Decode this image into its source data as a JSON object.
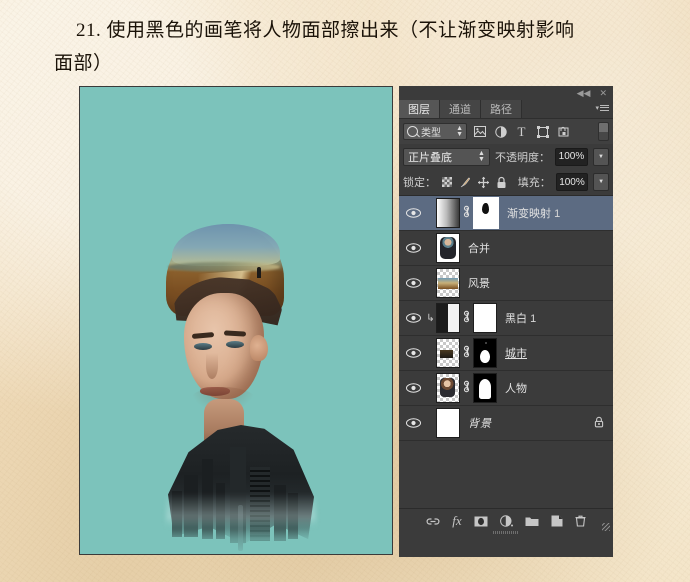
{
  "title": {
    "line1": "21. 使用黑色的画笔将人物面部擦出来（不让渐变映射影响",
    "line2": "面部）"
  },
  "panel": {
    "collapse_icon": "◀◀",
    "close_icon": "✕",
    "tabs": [
      {
        "label": "图层",
        "active": true
      },
      {
        "label": "通道",
        "active": false
      },
      {
        "label": "路径",
        "active": false
      }
    ],
    "filter_row": {
      "kind_label": "类型",
      "search_icon": "search-icon",
      "filter_icons": [
        "pixel-layer-filter-icon",
        "adjustment-layer-filter-icon",
        "type-layer-filter-icon",
        "shape-layer-filter-icon",
        "smart-object-filter-icon"
      ],
      "type_glyph": "T",
      "toggle_name": "filter-toggle"
    },
    "blend_row": {
      "blend_mode": "正片叠底",
      "opacity_label": "不透明度：",
      "opacity_value": "100%"
    },
    "lock_row": {
      "lock_label": "锁定：",
      "lock_icons": [
        "lock-transparent-pixels-icon",
        "lock-image-pixels-icon",
        "lock-position-icon",
        "lock-all-icon"
      ],
      "fill_label": "填充：",
      "fill_value": "100%"
    },
    "layers": [
      {
        "name": "渐变映射 1",
        "name_main": "渐变映射",
        "name_num": "1",
        "selected": true,
        "visible": true,
        "clipped": false,
        "thumb": "gradient",
        "linked": true,
        "mask": "brush-mark",
        "mask_active": true,
        "locked": false
      },
      {
        "name": "合并",
        "selected": false,
        "visible": true,
        "clipped": false,
        "thumb": "merged-portrait",
        "linked": false,
        "mask": null,
        "locked": false
      },
      {
        "name": "风景",
        "selected": false,
        "visible": true,
        "clipped": false,
        "thumb": "landscape",
        "linked": false,
        "mask": null,
        "locked": false
      },
      {
        "name": "黑白 1",
        "name_main": "黑白",
        "name_num": "1",
        "selected": false,
        "visible": true,
        "clipped": true,
        "thumb": "black-white-adjustment",
        "linked": true,
        "mask": "white",
        "mask_active": false,
        "locked": false
      },
      {
        "name": "城市",
        "selected": false,
        "visible": true,
        "clipped": false,
        "thumb": "city",
        "linked": true,
        "mask": "blob",
        "mask_active": false,
        "locked": false
      },
      {
        "name": "人物",
        "selected": false,
        "visible": true,
        "clipped": false,
        "thumb": "person",
        "linked": true,
        "mask": "bust",
        "mask_active": false,
        "locked": false
      },
      {
        "name": "背景",
        "selected": false,
        "visible": true,
        "clipped": false,
        "thumb": "white",
        "linked": false,
        "mask": null,
        "locked": true,
        "lock_icon": "🔒"
      }
    ],
    "bottom_bar": {
      "buttons": [
        {
          "name": "link-layers-button",
          "glyph": "⛓"
        },
        {
          "name": "layer-style-button",
          "glyph": "fx"
        },
        {
          "name": "add-layer-mask-button",
          "glyph": "◉"
        },
        {
          "name": "new-adjustment-layer-button",
          "glyph": "◐"
        },
        {
          "name": "new-group-button",
          "glyph": "🗀"
        },
        {
          "name": "new-layer-button",
          "glyph": "❐"
        },
        {
          "name": "delete-layer-button",
          "glyph": "🗑"
        }
      ]
    }
  },
  "colors": {
    "canvas_background": "#7cc3bb",
    "panel_background": "#3b3b3b",
    "selected_layer": "#5c6b82",
    "page_background": "#f0dcba"
  }
}
